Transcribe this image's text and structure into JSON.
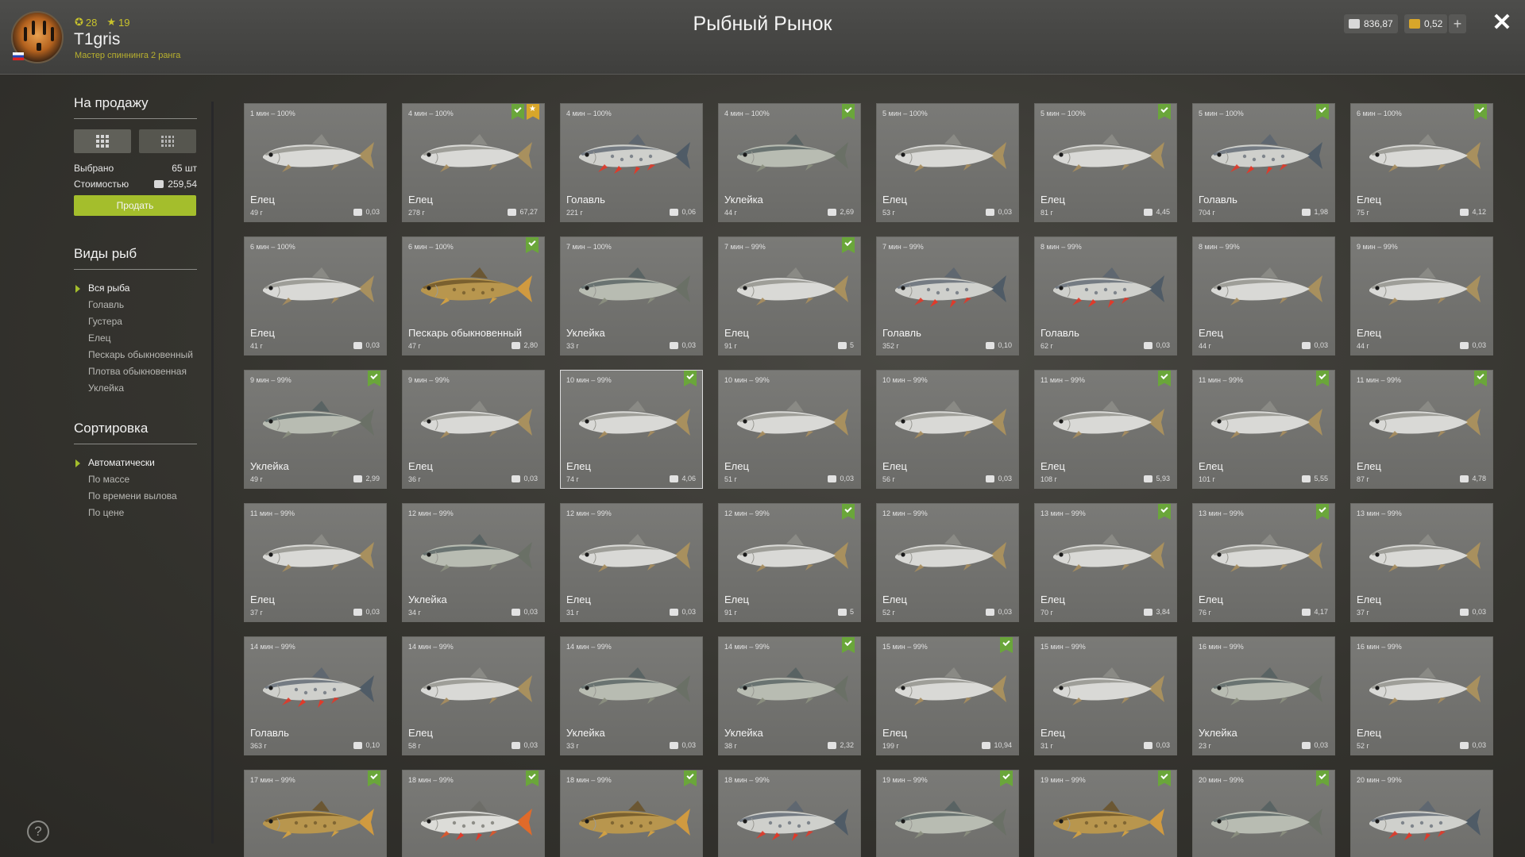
{
  "header": {
    "title": "Рыбный Рынок",
    "username": "T1gris",
    "rank": "Мастер спиннинга 2 ранга",
    "stat1": "28",
    "stat2": "19",
    "silver": "836,87",
    "gold": "0,52"
  },
  "sidebar": {
    "sale_title": "На продажу",
    "selected_label": "Выбрано",
    "selected_value": "65 шт",
    "cost_label": "Стоимостью",
    "cost_value": "259,54",
    "sell_label": "Продать",
    "types_title": "Виды рыб",
    "types": [
      "Вся рыба",
      "Голавль",
      "Густера",
      "Елец",
      "Пескарь обыкновенный",
      "Плотва обыкновенная",
      "Уклейка"
    ],
    "sort_title": "Сортировка",
    "sorts": [
      "Автоматически",
      "По массе",
      "По времени вылова",
      "По цене"
    ]
  },
  "icons": {
    "close": "close-icon",
    "help": "help-icon",
    "coin": "silver-coin-icon",
    "gold": "gold-coin-icon",
    "keepnet": "keepnet-mark-icon"
  },
  "colors": {
    "accent": "#a4be2c",
    "mark": "#6aa63a",
    "gold_mark": "#d8a62a"
  },
  "fish": [
    {
      "time": "1 мин – 100%",
      "name": "Елец",
      "weight": "49 г",
      "price": "0,03",
      "mark": "",
      "kind": "elets"
    },
    {
      "time": "4 мин – 100%",
      "name": "Елец",
      "weight": "278 г",
      "price": "67,27",
      "mark": "both",
      "kind": "elets"
    },
    {
      "time": "4 мин – 100%",
      "name": "Голавль",
      "weight": "221 г",
      "price": "0,06",
      "mark": "",
      "kind": "golavl"
    },
    {
      "time": "4 мин – 100%",
      "name": "Уклейка",
      "weight": "44 г",
      "price": "2,69",
      "mark": "green",
      "kind": "ukleyka"
    },
    {
      "time": "5 мин – 100%",
      "name": "Елец",
      "weight": "53 г",
      "price": "0,03",
      "mark": "",
      "kind": "elets"
    },
    {
      "time": "5 мин – 100%",
      "name": "Елец",
      "weight": "81 г",
      "price": "4,45",
      "mark": "green",
      "kind": "elets"
    },
    {
      "time": "5 мин – 100%",
      "name": "Голавль",
      "weight": "704 г",
      "price": "1,98",
      "mark": "green",
      "kind": "golavl"
    },
    {
      "time": "6 мин – 100%",
      "name": "Елец",
      "weight": "75 г",
      "price": "4,12",
      "mark": "green",
      "kind": "elets"
    },
    {
      "time": "6 мин – 100%",
      "name": "Елец",
      "weight": "41 г",
      "price": "0,03",
      "mark": "",
      "kind": "elets"
    },
    {
      "time": "6 мин – 100%",
      "name": "Пескарь обыкновенный",
      "weight": "47 г",
      "price": "2,80",
      "mark": "green",
      "kind": "peskar"
    },
    {
      "time": "7 мин – 100%",
      "name": "Уклейка",
      "weight": "33 г",
      "price": "0,03",
      "mark": "",
      "kind": "ukleyka"
    },
    {
      "time": "7 мин – 99%",
      "name": "Елец",
      "weight": "91 г",
      "price": "5",
      "mark": "green",
      "kind": "elets"
    },
    {
      "time": "7 мин – 99%",
      "name": "Голавль",
      "weight": "352 г",
      "price": "0,10",
      "mark": "",
      "kind": "golavl"
    },
    {
      "time": "8 мин – 99%",
      "name": "Голавль",
      "weight": "62 г",
      "price": "0,03",
      "mark": "",
      "kind": "golavl"
    },
    {
      "time": "8 мин – 99%",
      "name": "Елец",
      "weight": "44 г",
      "price": "0,03",
      "mark": "",
      "kind": "elets"
    },
    {
      "time": "9 мин – 99%",
      "name": "Елец",
      "weight": "44 г",
      "price": "0,03",
      "mark": "",
      "kind": "elets"
    },
    {
      "time": "9 мин – 99%",
      "name": "Уклейка",
      "weight": "49 г",
      "price": "2,99",
      "mark": "green",
      "kind": "ukleyka"
    },
    {
      "time": "9 мин – 99%",
      "name": "Елец",
      "weight": "36 г",
      "price": "0,03",
      "mark": "",
      "kind": "elets"
    },
    {
      "time": "10 мин – 99%",
      "name": "Елец",
      "weight": "74 г",
      "price": "4,06",
      "mark": "green",
      "kind": "elets",
      "selected": true
    },
    {
      "time": "10 мин – 99%",
      "name": "Елец",
      "weight": "51 г",
      "price": "0,03",
      "mark": "",
      "kind": "elets"
    },
    {
      "time": "10 мин – 99%",
      "name": "Елец",
      "weight": "56 г",
      "price": "0,03",
      "mark": "",
      "kind": "elets"
    },
    {
      "time": "11 мин – 99%",
      "name": "Елец",
      "weight": "108 г",
      "price": "5,93",
      "mark": "green",
      "kind": "elets"
    },
    {
      "time": "11 мин – 99%",
      "name": "Елец",
      "weight": "101 г",
      "price": "5,55",
      "mark": "green",
      "kind": "elets"
    },
    {
      "time": "11 мин – 99%",
      "name": "Елец",
      "weight": "87 г",
      "price": "4,78",
      "mark": "green",
      "kind": "elets"
    },
    {
      "time": "11 мин – 99%",
      "name": "Елец",
      "weight": "37 г",
      "price": "0,03",
      "mark": "",
      "kind": "elets"
    },
    {
      "time": "12 мин – 99%",
      "name": "Уклейка",
      "weight": "34 г",
      "price": "0,03",
      "mark": "",
      "kind": "ukleyka"
    },
    {
      "time": "12 мин – 99%",
      "name": "Елец",
      "weight": "31 г",
      "price": "0,03",
      "mark": "",
      "kind": "elets"
    },
    {
      "time": "12 мин – 99%",
      "name": "Елец",
      "weight": "91 г",
      "price": "5",
      "mark": "green",
      "kind": "elets"
    },
    {
      "time": "12 мин – 99%",
      "name": "Елец",
      "weight": "52 г",
      "price": "0,03",
      "mark": "",
      "kind": "elets"
    },
    {
      "time": "13 мин – 99%",
      "name": "Елец",
      "weight": "70 г",
      "price": "3,84",
      "mark": "green",
      "kind": "elets"
    },
    {
      "time": "13 мин – 99%",
      "name": "Елец",
      "weight": "76 г",
      "price": "4,17",
      "mark": "green",
      "kind": "elets"
    },
    {
      "time": "13 мин – 99%",
      "name": "Елец",
      "weight": "37 г",
      "price": "0,03",
      "mark": "",
      "kind": "elets"
    },
    {
      "time": "14 мин – 99%",
      "name": "Голавль",
      "weight": "363 г",
      "price": "0,10",
      "mark": "",
      "kind": "golavl"
    },
    {
      "time": "14 мин – 99%",
      "name": "Елец",
      "weight": "58 г",
      "price": "0,03",
      "mark": "",
      "kind": "elets"
    },
    {
      "time": "14 мин – 99%",
      "name": "Уклейка",
      "weight": "33 г",
      "price": "0,03",
      "mark": "",
      "kind": "ukleyka"
    },
    {
      "time": "14 мин – 99%",
      "name": "Уклейка",
      "weight": "38 г",
      "price": "2,32",
      "mark": "green",
      "kind": "ukleyka"
    },
    {
      "time": "15 мин – 99%",
      "name": "Елец",
      "weight": "199 г",
      "price": "10,94",
      "mark": "green",
      "kind": "elets"
    },
    {
      "time": "15 мин – 99%",
      "name": "Елец",
      "weight": "31 г",
      "price": "0,03",
      "mark": "",
      "kind": "elets"
    },
    {
      "time": "16 мин – 99%",
      "name": "Уклейка",
      "weight": "23 г",
      "price": "0,03",
      "mark": "",
      "kind": "ukleyka"
    },
    {
      "time": "16 мин – 99%",
      "name": "Елец",
      "weight": "52 г",
      "price": "0,03",
      "mark": "",
      "kind": "elets"
    },
    {
      "time": "17 мин – 99%",
      "name": "",
      "weight": "",
      "price": "",
      "mark": "green",
      "kind": "peskar"
    },
    {
      "time": "18 мин – 99%",
      "name": "",
      "weight": "",
      "price": "",
      "mark": "green",
      "kind": "plotva"
    },
    {
      "time": "18 мин – 99%",
      "name": "",
      "weight": "",
      "price": "",
      "mark": "green",
      "kind": "peskar"
    },
    {
      "time": "18 мин – 99%",
      "name": "",
      "weight": "",
      "price": "",
      "mark": "",
      "kind": "golavl"
    },
    {
      "time": "19 мин – 99%",
      "name": "",
      "weight": "",
      "price": "",
      "mark": "green",
      "kind": "ukleyka"
    },
    {
      "time": "19 мин – 99%",
      "name": "",
      "weight": "",
      "price": "",
      "mark": "green",
      "kind": "peskar"
    },
    {
      "time": "20 мин – 99%",
      "name": "",
      "weight": "",
      "price": "",
      "mark": "green",
      "kind": "ukleyka"
    },
    {
      "time": "20 мин – 99%",
      "name": "",
      "weight": "",
      "price": "",
      "mark": "",
      "kind": "golavl"
    }
  ]
}
